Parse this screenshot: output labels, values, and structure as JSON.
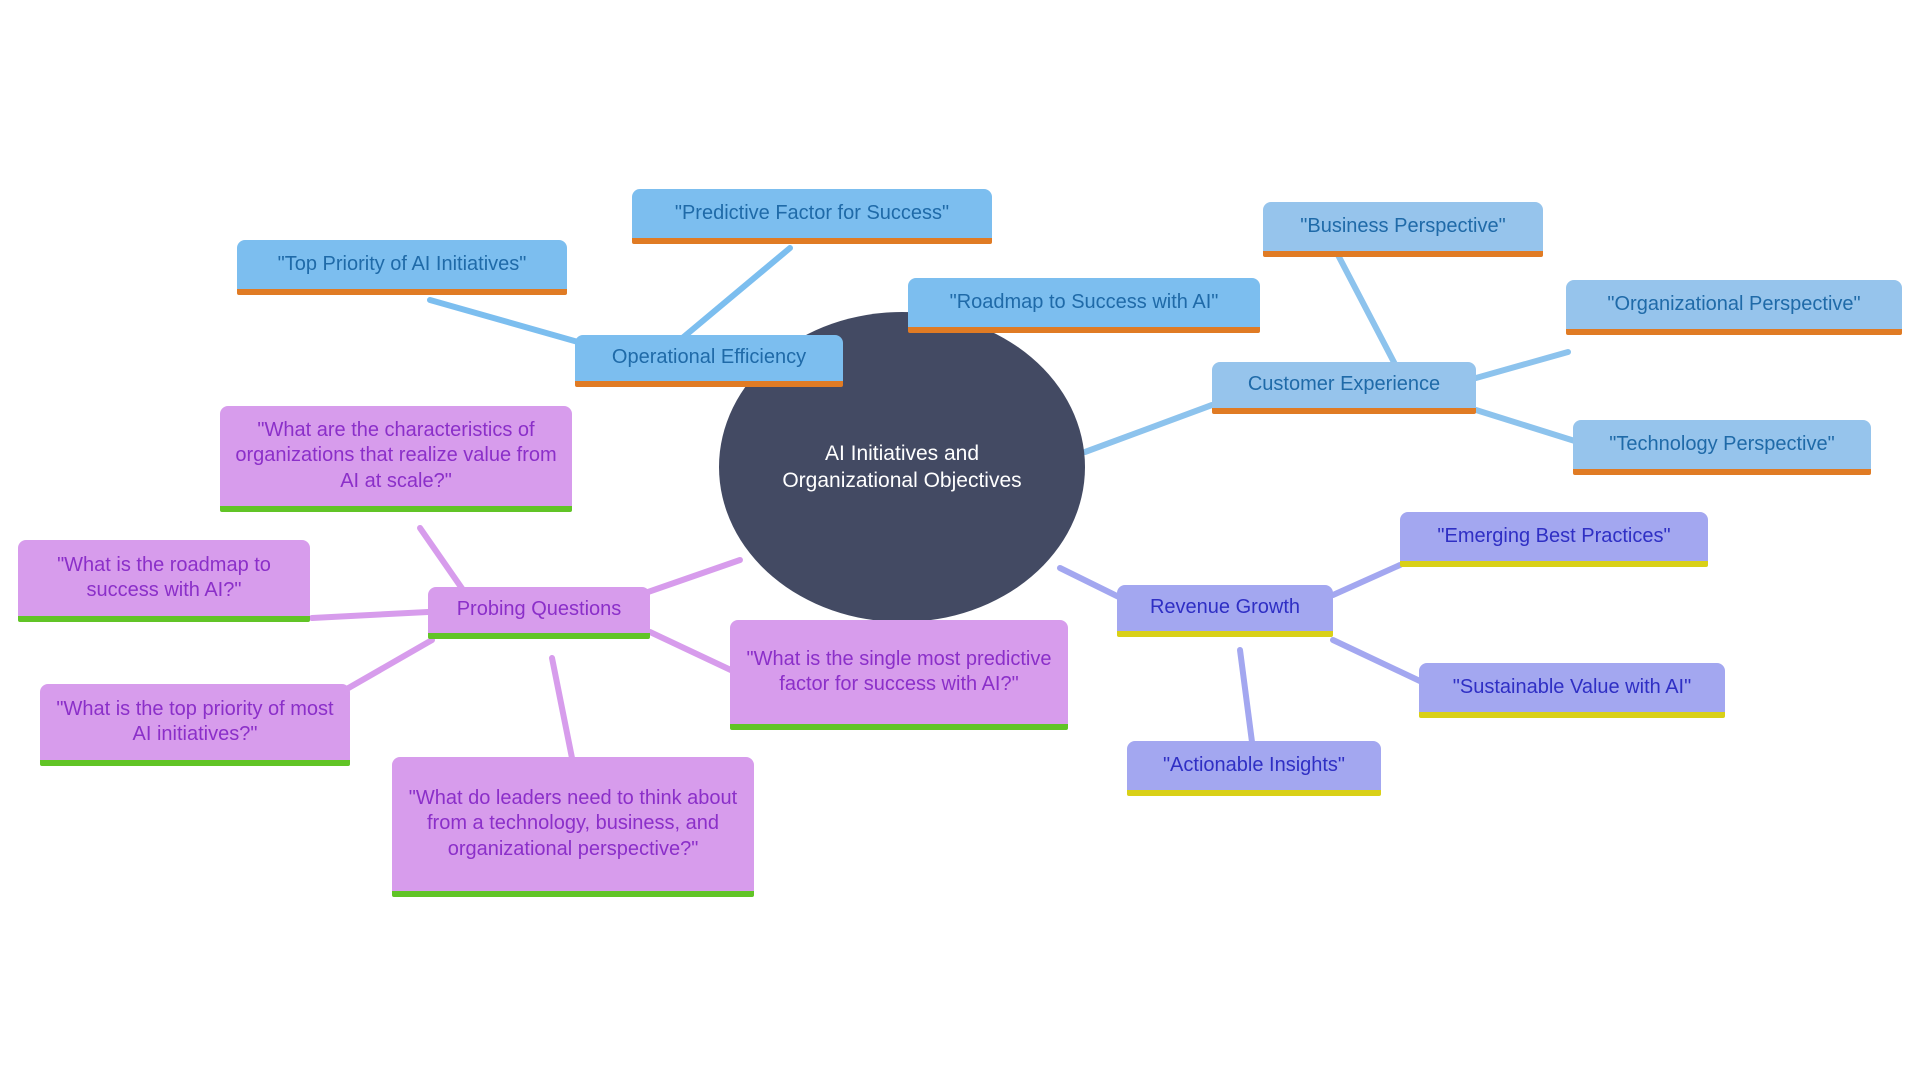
{
  "diagram": {
    "type": "mind-map",
    "title": "AI Initiatives and Organizational Objectives",
    "background_color": "#ffffff",
    "root": {
      "id": "root",
      "label": "AI Initiatives and Organizational Objectives",
      "fill": "#434a63",
      "text_color": "#ffffff"
    },
    "branches": [
      {
        "id": "operational-efficiency",
        "label": "Operational Efficiency",
        "fill": "#7cbeef",
        "text_color": "#1f6aa8",
        "underline_color": "#e07b24",
        "edge_color": "#7cbeef",
        "children": [
          {
            "id": "top-priority",
            "label": "\"Top Priority of AI Initiatives\""
          },
          {
            "id": "predictive-factor",
            "label": "\"Predictive Factor for Success\""
          },
          {
            "id": "roadmap-success",
            "label": "\"Roadmap to Success with AI\""
          }
        ]
      },
      {
        "id": "customer-experience",
        "label": "Customer Experience",
        "fill": "#96c4ec",
        "text_color": "#1f6aa8",
        "underline_color": "#e07b24",
        "edge_color": "#8dc3ed",
        "children": [
          {
            "id": "business-perspective",
            "label": "\"Business Perspective\""
          },
          {
            "id": "organizational-perspective",
            "label": "\"Organizational Perspective\""
          },
          {
            "id": "technology-perspective",
            "label": "\"Technology Perspective\""
          }
        ]
      },
      {
        "id": "revenue-growth",
        "label": "Revenue Growth",
        "fill": "#a3a7f0",
        "text_color": "#2f2fc4",
        "underline_color": "#d9d017",
        "edge_color": "#a3a7f0",
        "children": [
          {
            "id": "emerging-best-practices",
            "label": "\"Emerging Best Practices\""
          },
          {
            "id": "sustainable-value",
            "label": "\"Sustainable Value with AI\""
          },
          {
            "id": "actionable-insights",
            "label": "\"Actionable Insights\""
          }
        ]
      },
      {
        "id": "probing-questions",
        "label": "Probing Questions",
        "fill": "#d79cec",
        "text_color": "#8b2fc9",
        "underline_color": "#61c426",
        "edge_color": "#d79cec",
        "children": [
          {
            "id": "q-characteristics",
            "label": "\"What are the characteristics of organizations that realize value from AI at scale?\""
          },
          {
            "id": "q-roadmap",
            "label": "\"What is the roadmap to success with AI?\""
          },
          {
            "id": "q-top-priority",
            "label": "\"What is the top priority of most AI initiatives?\""
          },
          {
            "id": "q-leaders-perspective",
            "label": "\"What do leaders need to think about from a technology, business, and organizational perspective?\""
          },
          {
            "id": "q-single-most-predictive",
            "label": "\"What is the single most predictive factor for success with AI?\""
          }
        ]
      }
    ]
  }
}
